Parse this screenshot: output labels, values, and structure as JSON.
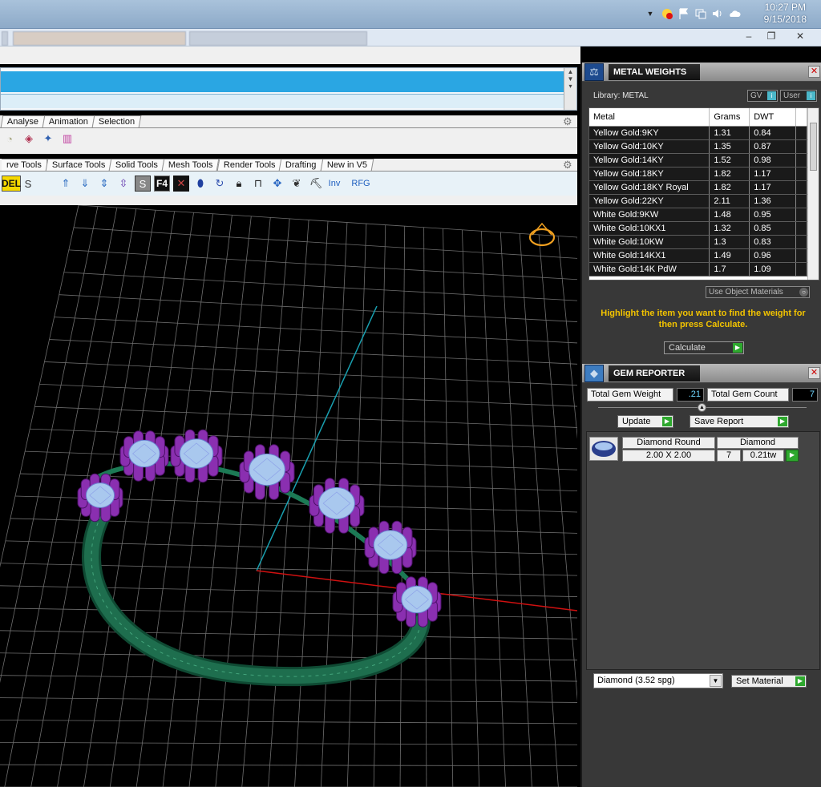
{
  "taskbar": {
    "time": "10:27 PM",
    "date": "9/15/2018"
  },
  "toolbars": {
    "row1_tabs": [
      "Analyse",
      "Animation",
      "Selection"
    ],
    "row2_tabs": [
      "rve Tools",
      "Surface Tools",
      "Solid Tools",
      "Mesh Tools",
      "Render Tools",
      "Drafting",
      "New in V5"
    ],
    "row2_text": {
      "del": "DEL",
      "s": "S",
      "f4": "F4",
      "inv": "Inv",
      "rfg": "RFG"
    }
  },
  "metal_weights": {
    "title": "METAL WEIGHTS",
    "library_label": "Library: METAL",
    "gv_label": "GV",
    "user_label": "User",
    "columns": [
      "Metal",
      "Grams",
      "DWT"
    ],
    "rows": [
      [
        "Yellow Gold:9KY",
        "1.31",
        "0.84"
      ],
      [
        "Yellow Gold:10KY",
        "1.35",
        "0.87"
      ],
      [
        "Yellow Gold:14KY",
        "1.52",
        "0.98"
      ],
      [
        "Yellow Gold:18KY",
        "1.82",
        "1.17"
      ],
      [
        "Yellow Gold:18KY Royal",
        "1.82",
        "1.17"
      ],
      [
        "Yellow Gold:22KY",
        "2.11",
        "1.36"
      ],
      [
        "White Gold:9KW",
        "1.48",
        "0.95"
      ],
      [
        "White Gold:10KX1",
        "1.32",
        "0.85"
      ],
      [
        "White Gold:10KW",
        "1.3",
        "0.83"
      ],
      [
        "White Gold:14KX1",
        "1.49",
        "0.96"
      ],
      [
        "White Gold:14K PdW",
        "1.7",
        "1.09"
      ]
    ],
    "use_object_materials": "Use Object Materials",
    "hint": "Highlight the item you want to find the weight for then press Calculate.",
    "calculate": "Calculate"
  },
  "gem_reporter": {
    "title": "GEM REPORTER",
    "total_weight_label": "Total Gem Weight",
    "total_weight_value": ".21",
    "total_count_label": "Total Gem Count",
    "total_count_value": "7",
    "update": "Update",
    "save_report": "Save Report",
    "gem": {
      "shape": "Diamond Round",
      "size": "2.00 X 2.00",
      "material": "Diamond",
      "count": "7",
      "weight": "0.21tw"
    },
    "material_select": "Diamond     (3.52 spg)",
    "set_material": "Set Material"
  },
  "colors": {
    "taskbar": "#a9c2db",
    "command_blue": "#2aa6e3",
    "panel_bg": "#383838",
    "hint_yellow": "#f2c300",
    "ring_band": "#1e6e4e",
    "prongs": "#8a2fb0",
    "gems": "#a9c8ee",
    "axis_x": "#d01010",
    "axis_z": "#19a0b0"
  }
}
